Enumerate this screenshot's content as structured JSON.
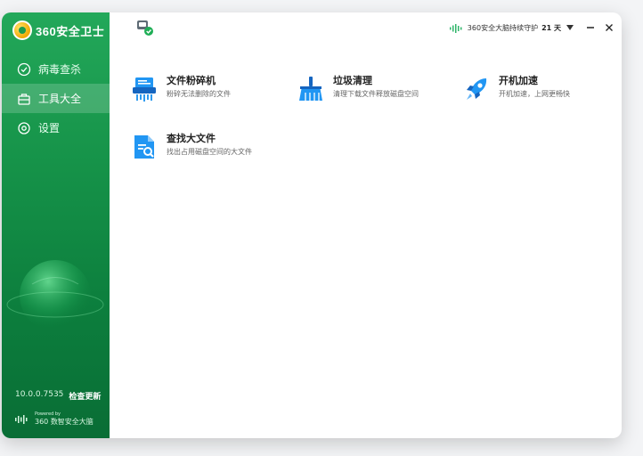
{
  "app": {
    "logo_text": "360安全卫士",
    "version": "10.0.0.7535",
    "update_label": "检查更新",
    "powered_by": "Powered by",
    "powered_brand": "360 数智安全大脑"
  },
  "sidebar": {
    "items": [
      {
        "label": "病毒查杀",
        "icon": "shield-check-icon"
      },
      {
        "label": "工具大全",
        "icon": "toolbox-icon",
        "active": true
      },
      {
        "label": "设置",
        "icon": "gear-icon"
      }
    ]
  },
  "header": {
    "guard_text": "360安全大脑持续守护",
    "guard_days": "21 天"
  },
  "tools": [
    {
      "title": "文件粉碎机",
      "desc": "粉碎无法删除的文件",
      "icon": "shredder-icon"
    },
    {
      "title": "垃圾清理",
      "desc": "清理下载文件释放磁盘空间",
      "icon": "broom-icon"
    },
    {
      "title": "开机加速",
      "desc": "开机加速，上网更畅快",
      "icon": "rocket-icon"
    },
    {
      "title": "查找大文件",
      "desc": "找出占用磁盘空间的大文件",
      "icon": "file-search-icon"
    }
  ],
  "colors": {
    "brand_green": "#169349",
    "accent_blue": "#1e88e5"
  }
}
